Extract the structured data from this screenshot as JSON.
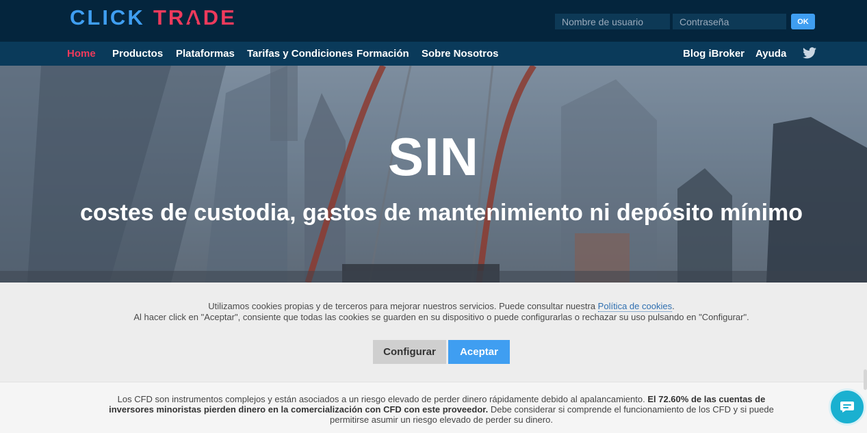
{
  "header": {
    "logo_text": "CLICKTRADE",
    "logo_colors": {
      "click": "#3f9ef1",
      "trade": "#ee3a5c"
    },
    "username_placeholder": "Nombre de usuario",
    "password_placeholder": "Contraseña",
    "ok_label": "OK"
  },
  "nav": {
    "items": [
      {
        "label": "Home",
        "active": true
      },
      {
        "label": "Productos"
      },
      {
        "label": "Plataformas"
      },
      {
        "label": "Tarifas y Condiciones"
      },
      {
        "label": "Formación"
      },
      {
        "label": "Sobre Nosotros"
      }
    ],
    "right_items": [
      {
        "label": "Blog iBroker"
      },
      {
        "label": "Ayuda"
      }
    ],
    "social_icon": "twitter-icon"
  },
  "hero": {
    "title": "SIN",
    "subtitle": "costes de custodia, gastos de mantenimiento ni depósito mínimo"
  },
  "cookie_banner": {
    "line1_prefix": "Utilizamos cookies propias y de terceros para mejorar nuestros servicios. Puede consultar nuestra ",
    "policy_link": "Política de cookies",
    "line1_suffix": ".",
    "line2": "Al hacer click en \"Aceptar\", consiente que todas las cookies se guarden en su dispositivo o puede configurarlas o rechazar su uso pulsando en \"Configurar\".",
    "configure_label": "Configurar",
    "accept_label": "Aceptar"
  },
  "risk_warning": {
    "part1": "Los CFD son instrumentos complejos y están asociados a un riesgo elevado de perder dinero rápidamente debido al apalancamiento. ",
    "bold": "El 72.60% de las cuentas de inversores minoristas pierden dinero en la comercialización con CFD con este proveedor.",
    "part2": " Debe considerar si comprende el funcionamiento de los CFD y si puede permitirse asumir un riesgo elevado de perder su dinero."
  },
  "chat": {
    "icon": "chat-icon"
  }
}
